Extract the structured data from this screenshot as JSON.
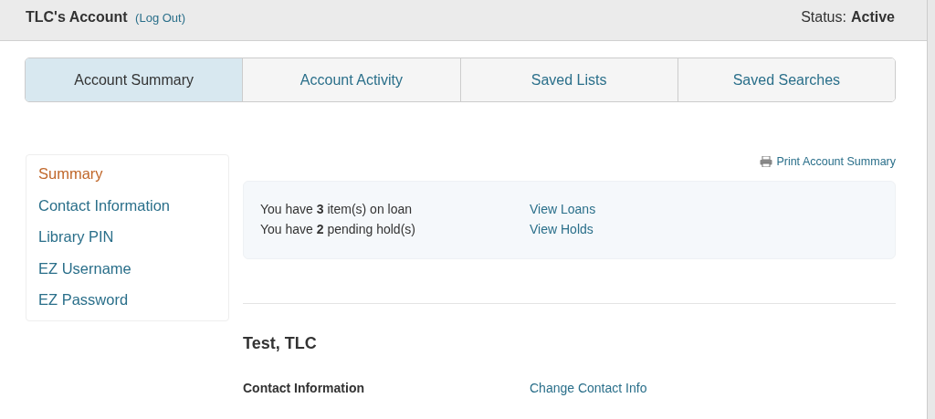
{
  "header": {
    "title": "TLC's Account",
    "logout": "(Log Out)",
    "status_label": "Status:",
    "status_value": "Active"
  },
  "tabs": [
    {
      "label": "Account Summary",
      "selected": true
    },
    {
      "label": "Account Activity",
      "selected": false
    },
    {
      "label": "Saved Lists",
      "selected": false
    },
    {
      "label": "Saved Searches",
      "selected": false
    }
  ],
  "sidebar": {
    "items": [
      {
        "label": "Summary",
        "selected": true
      },
      {
        "label": "Contact Information",
        "selected": false
      },
      {
        "label": "Library PIN",
        "selected": false
      },
      {
        "label": "EZ Username",
        "selected": false
      },
      {
        "label": "EZ Password",
        "selected": false
      }
    ]
  },
  "print_link": "Print Account Summary",
  "summary": [
    {
      "text": "You have **3** item(s) on loan",
      "link": "View Loans"
    },
    {
      "text": "You have **2** pending hold(s)",
      "link": "View Holds"
    }
  ],
  "patron": {
    "name": "Test, TLC",
    "section_label": "Contact Information",
    "section_link": "Change Contact Info"
  }
}
